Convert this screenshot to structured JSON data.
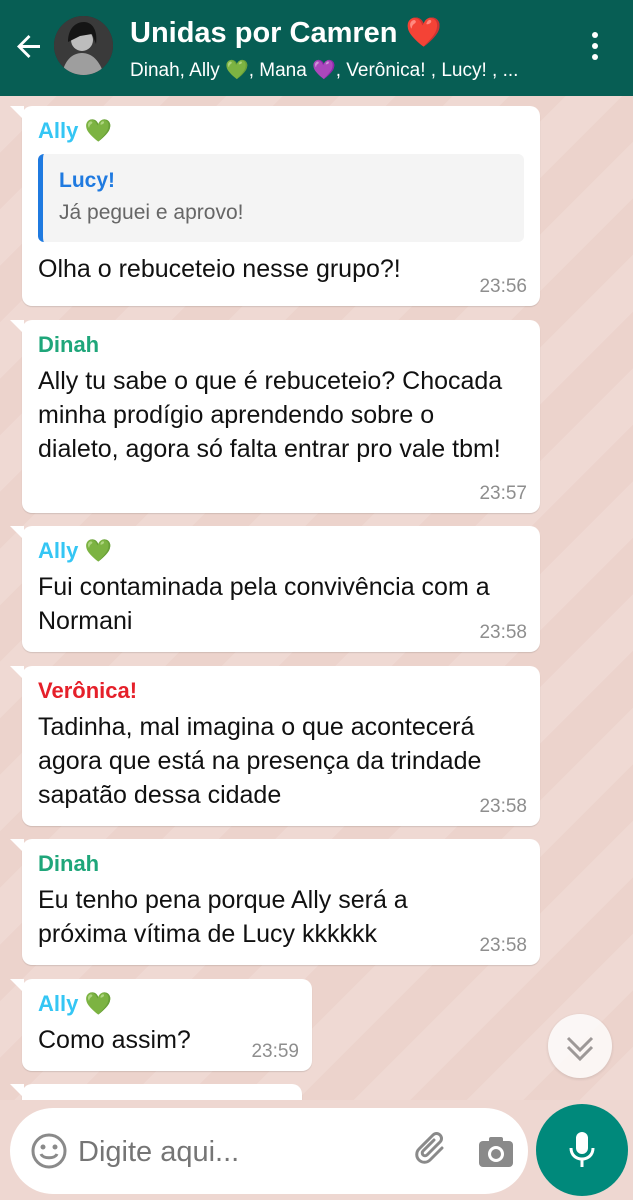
{
  "header": {
    "title": "Unidas por Camren ❤️",
    "subtitle": "Dinah, Ally 💚, Mana 💜, Verônica! , Lucy! , ..."
  },
  "messages": [
    {
      "sender": "Ally 💚",
      "sender_color": "#35c6f4",
      "quote_name": "Lucy!",
      "quote_text": "Já peguei e aprovo!",
      "text": "Olha o rebuceteio nesse grupo?!",
      "time": "23:56"
    },
    {
      "sender": "Dinah",
      "sender_color": "#1fa67a",
      "text": "Ally tu sabe o que é rebuceteio? Chocada minha prodígio aprendendo sobre o dialeto, agora só falta entrar pro vale tbm!",
      "time": "23:57"
    },
    {
      "sender": "Ally 💚",
      "sender_color": "#35c6f4",
      "text": "Fui contaminada pela convivência com a Normani",
      "time": "23:58"
    },
    {
      "sender": "Verônica!",
      "sender_color": "#e5202a",
      "text": "Tadinha, mal imagina o que acontecerá agora que está na presença da trindade sapatão dessa cidade",
      "time": "23:58"
    },
    {
      "sender": "Dinah",
      "sender_color": "#1fa67a",
      "text": "Eu tenho pena porque Ally será a próxima vítima de Lucy kkkkkk",
      "time": "23:58"
    },
    {
      "sender": "Ally 💚",
      "sender_color": "#35c6f4",
      "text": "Como assim?",
      "time": "23:59"
    }
  ],
  "input": {
    "placeholder": "Digite aqui..."
  },
  "colors": {
    "header": "#075e54",
    "mic_button": "#00897b",
    "quote_bar": "#1f7ae0"
  }
}
